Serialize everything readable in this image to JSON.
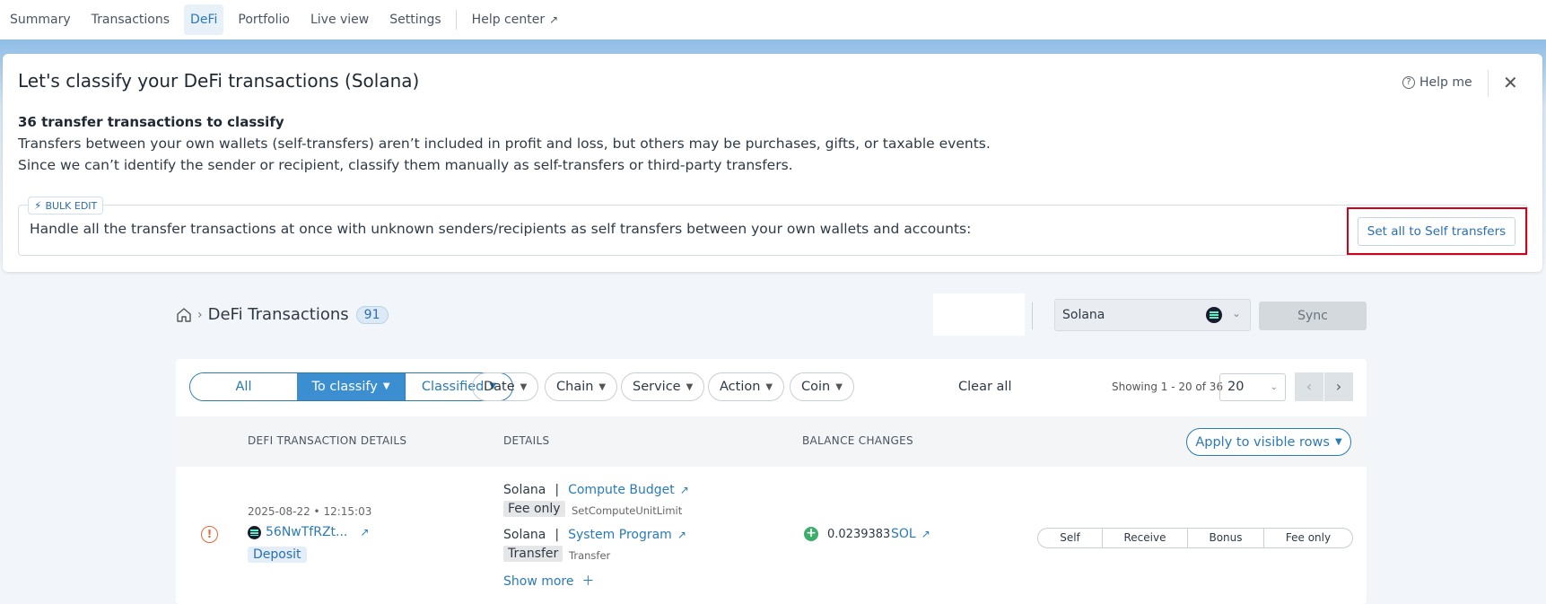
{
  "nav": {
    "tabs": [
      "Summary",
      "Transactions",
      "DeFi",
      "Portfolio",
      "Live view",
      "Settings"
    ],
    "active_tab": "DeFi",
    "help_center": "Help center"
  },
  "panel": {
    "title": "Let's classify your DeFi transactions (Solana)",
    "help_me": "Help me",
    "count_title": "36 transfer transactions to classify",
    "desc1": "Transfers between your own wallets (self-transfers) aren’t included in profit and loss, but others may be purchases, gifts, or taxable events.",
    "desc2": "Since we can’t identify the sender or recipient, classify them manually as self-transfers or third-party transfers.",
    "bulk_badge": "BULK EDIT",
    "bulk_text": "Handle all the transfer transactions at once with unknown senders/recipients as self transfers between your own wallets and accounts:",
    "set_all_button": "Set all to Self transfers"
  },
  "toolbar": {
    "breadcrumb_title": "DeFi Transactions",
    "count": "91",
    "chain": "Solana",
    "sync": "Sync"
  },
  "filters": {
    "segments": [
      "All",
      "To classify",
      "Classified"
    ],
    "active_segment": "To classify",
    "dropdowns": [
      "Date",
      "Chain",
      "Service",
      "Action",
      "Coin"
    ],
    "clear_all": "Clear all",
    "showing": "Showing 1 - 20 of 36",
    "page_size": "20"
  },
  "table": {
    "headers": [
      "DEFI TRANSACTION DETAILS",
      "DETAILS",
      "BALANCE CHANGES"
    ],
    "apply_button": "Apply to visible rows",
    "rows": [
      {
        "date": "2025-08-22 • 12:15:03",
        "hash": "56NwTfRZt...",
        "type": "Deposit",
        "details": [
          {
            "chain": "Solana",
            "program": "Compute Budget",
            "tag": "Fee only",
            "sub": "SetComputeUnitLimit"
          },
          {
            "chain": "Solana",
            "program": "System Program",
            "tag": "Transfer",
            "sub": "Transfer"
          }
        ],
        "show_more": "Show more",
        "amount": "0.0239383",
        "coin": "SOL",
        "choices": [
          "Self",
          "Receive",
          "Bonus",
          "Fee only"
        ]
      }
    ]
  }
}
